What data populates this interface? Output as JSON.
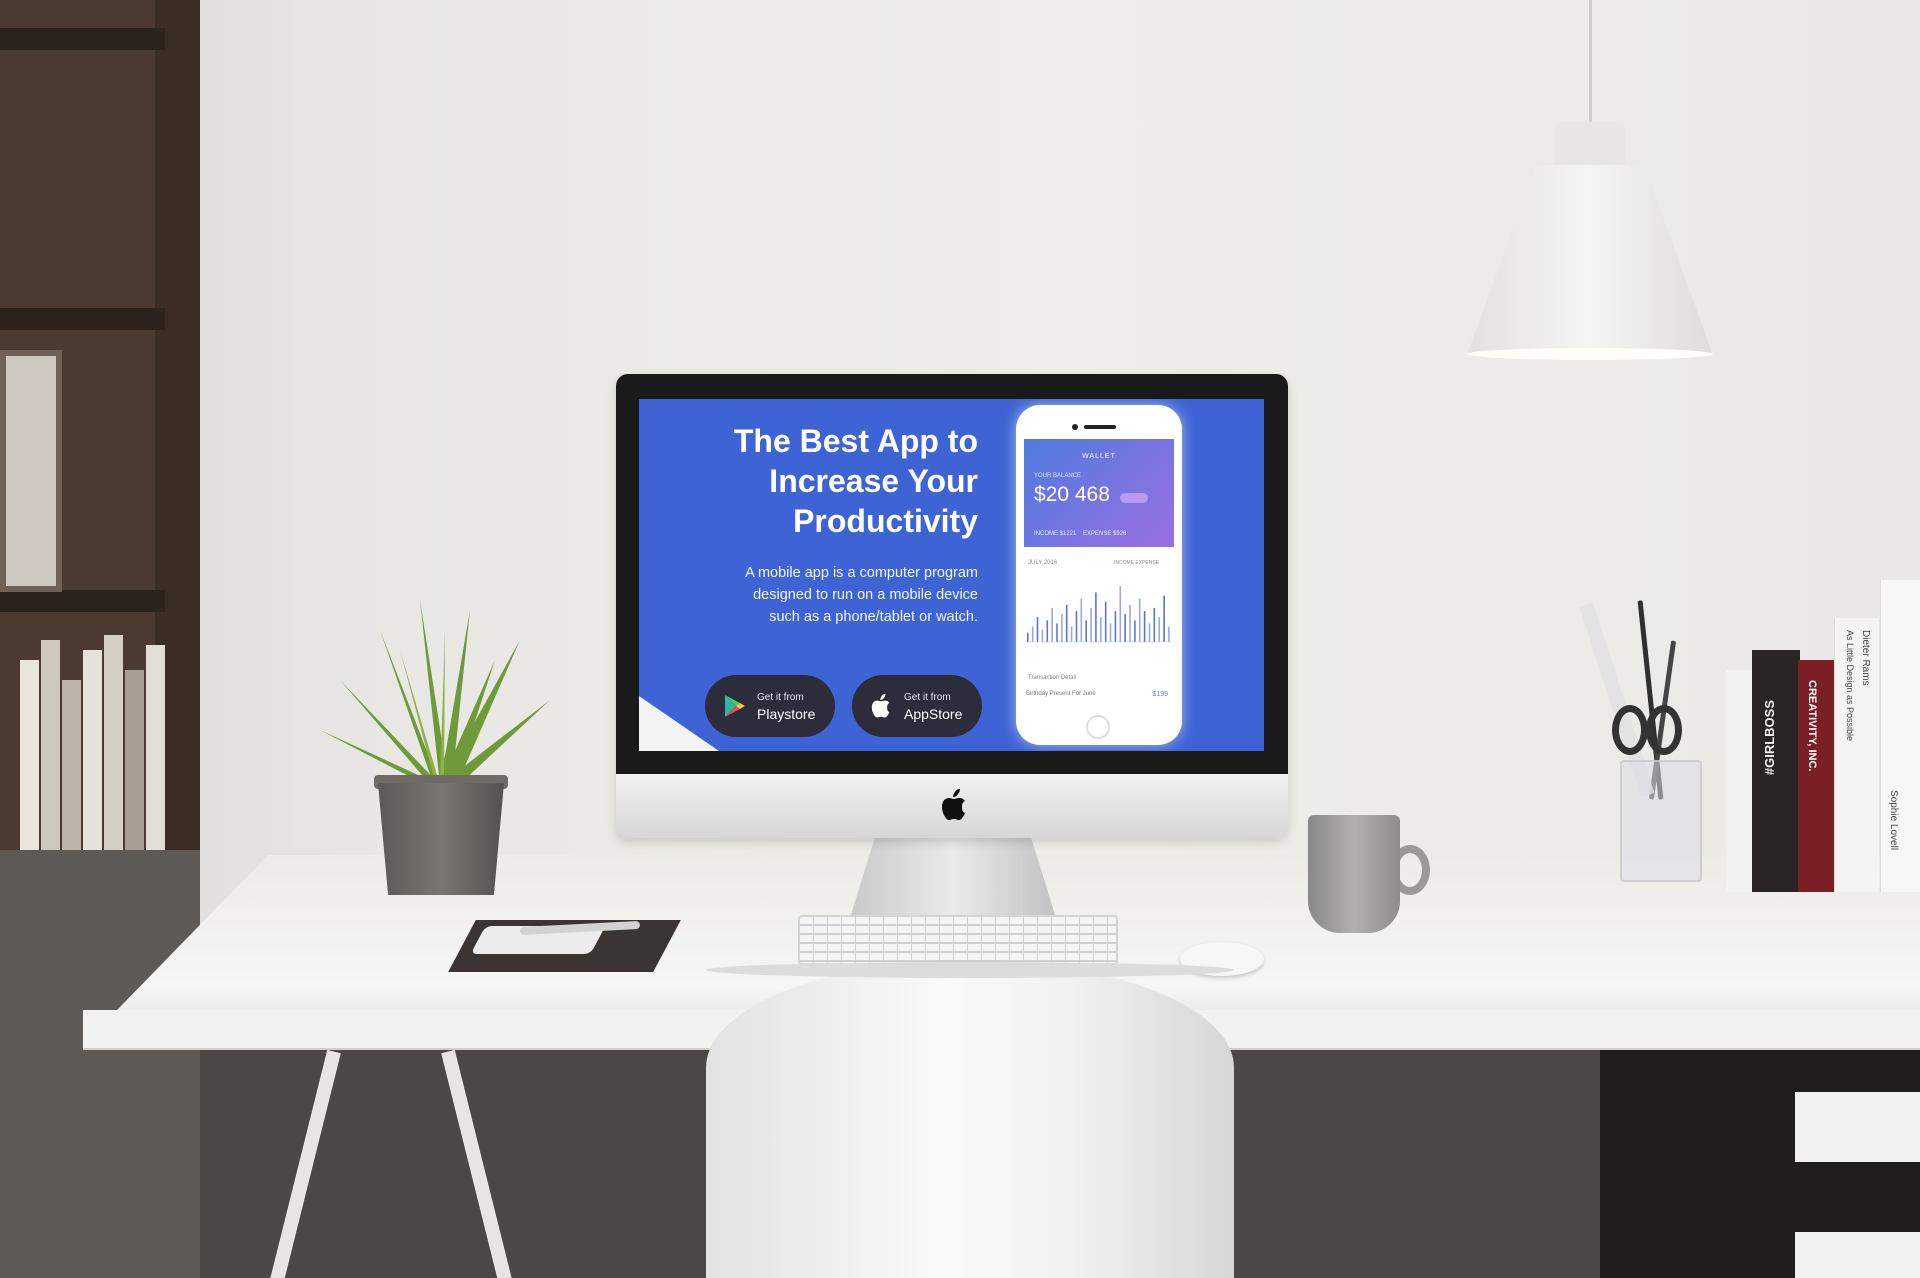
{
  "screen": {
    "headline": [
      "The Best App to",
      "Increase Your",
      "Productivity"
    ],
    "subtext": [
      "A mobile app is a computer program",
      "designed to run on a mobile device",
      "such as a phone/tablet or watch."
    ],
    "buttons": [
      {
        "small": "Get it from",
        "big": "Playstore",
        "icon": "play-store-icon"
      },
      {
        "small": "Get it from",
        "big": "AppStore",
        "icon": "apple-icon"
      }
    ],
    "colors": {
      "background": "#3e63d4",
      "button": "#2c2c3a",
      "card_start": "#4f7be0",
      "card_end": "#9a6fe0"
    }
  },
  "phone_app": {
    "title": "WALLET",
    "balance_label": "YOUR BALANCE",
    "balance": "$20 468",
    "income": "INCOME  $1221",
    "expense": "EXPENSE  $926",
    "month": "JULY 2016",
    "legend": "INCOME   EXPENSE",
    "transactions_label": "Transaction Detail",
    "transaction": {
      "name": "Birthday Present For June",
      "price": "$199"
    },
    "bars": [
      0.15,
      0.25,
      0.4,
      0.2,
      0.35,
      0.55,
      0.3,
      0.45,
      0.6,
      0.25,
      0.5,
      0.7,
      0.35,
      0.55,
      0.8,
      0.4,
      0.65,
      0.3,
      0.5,
      0.9,
      0.45,
      0.6,
      0.35,
      0.7,
      0.5,
      0.3,
      0.55,
      0.4,
      0.75,
      0.25
    ]
  },
  "books": {
    "spine_1": "#GIRLBOSS",
    "spine_2": "CREATIVITY, INC.",
    "spine_3": "Dieter Rams",
    "spine_3b": "As Little Design as Possible",
    "spine_4": "Sophie Lovell"
  }
}
